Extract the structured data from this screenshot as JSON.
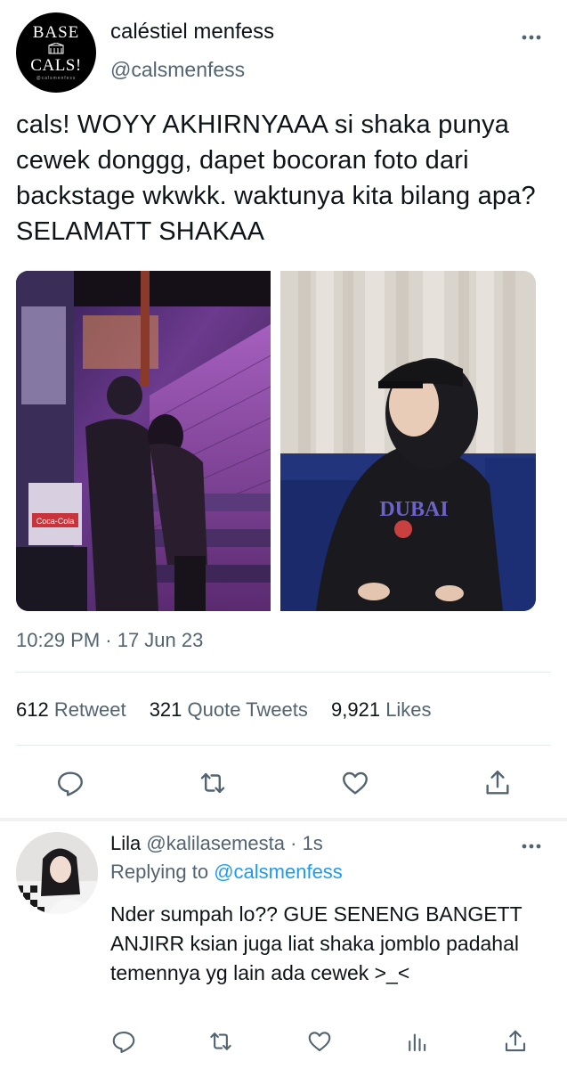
{
  "account": {
    "display_name": "caléstiel menfess",
    "handle": "@calsmenfess",
    "avatar_line1": "BASE",
    "avatar_line2": "CALS!",
    "avatar_line3": "@calsmenfess"
  },
  "tweet": {
    "text": "cals! WOYY AKHIRNYAAA si shaka punya cewek donggg, dapet bocoran foto dari backstage wkwkk. waktunya kita bilang apa? SELAMATT SHAKAA",
    "timestamp": "10:29 PM · 17 Jun 23",
    "stats": {
      "retweets_count": "612",
      "retweets_label": "Retweet",
      "quotes_count": "321",
      "quotes_label": "Quote Tweets",
      "likes_count": "9,921",
      "likes_label": "Likes"
    },
    "photo_left_sign": "Coca-Cola",
    "photo_right_hoodie": "DUBAI"
  },
  "reply": {
    "name": "Lila",
    "handle": "@kalilasemesta",
    "time": "· 1s",
    "replying_prefix": "Replying to",
    "replying_to": "@calsmenfess",
    "text": "Nder sumpah lo?? GUE SENENG BANGETT ANJIRR ksian juga liat shaka jomblo padahal temennya yg lain ada cewek >_<"
  },
  "icons": {
    "more": "more-horizontal-icon",
    "reply": "reply-icon",
    "retweet": "retweet-icon",
    "like": "heart-icon",
    "share": "share-icon",
    "views": "analytics-icon"
  },
  "colors": {
    "primary_text": "#0f1419",
    "secondary_text": "#536471",
    "accent": "#1d9bf0",
    "divider": "#e6e9eb"
  }
}
